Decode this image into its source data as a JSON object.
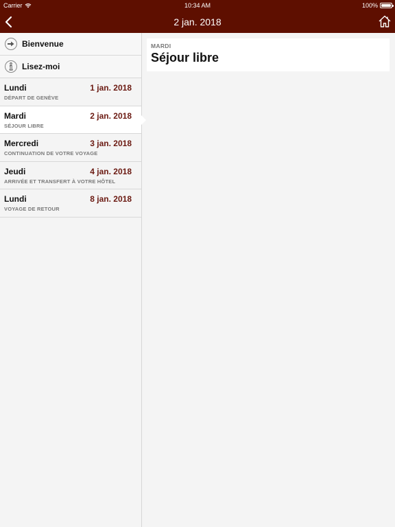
{
  "status": {
    "carrier": "Carrier",
    "time": "10:34 AM",
    "battery": "100%",
    "battery_level": 1.0
  },
  "nav": {
    "title": "2 jan. 2018",
    "back_icon": "chevron-left-icon",
    "home_icon": "home-icon"
  },
  "sidebar": {
    "menu": [
      {
        "label": "Bienvenue",
        "icon": "arrow-right-circle-icon"
      },
      {
        "label": "Lisez-moi",
        "icon": "info-circle-icon"
      }
    ],
    "days": [
      {
        "name": "Lundi",
        "date": "1 jan. 2018",
        "subtitle": "DÉPART DE GENÈVE"
      },
      {
        "name": "Mardi",
        "date": "2 jan. 2018",
        "subtitle": "SÉJOUR LIBRE"
      },
      {
        "name": "Mercredi",
        "date": "3 jan. 2018",
        "subtitle": "CONTINUATION DE VOTRE VOYAGE"
      },
      {
        "name": "Jeudi",
        "date": "4 jan. 2018",
        "subtitle": "ARRIVÉE ET TRANSFERT À VOTRE HÔTEL"
      },
      {
        "name": "Lundi",
        "date": "8 jan. 2018",
        "subtitle": "VOYAGE DE RETOUR"
      }
    ]
  },
  "detail": {
    "day": "MARDI",
    "title": "Séjour libre"
  },
  "colors": {
    "brand": "#5e0f00",
    "date_text": "#6b1a12"
  }
}
